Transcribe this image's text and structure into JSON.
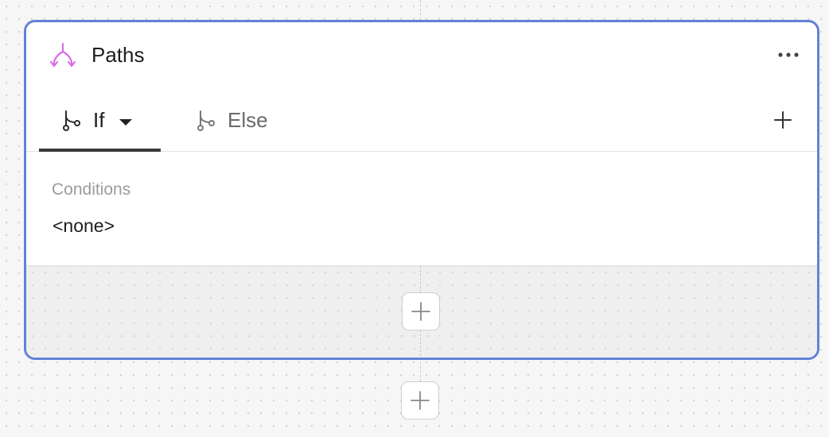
{
  "card": {
    "title": "Paths",
    "title_icon": "paths-split-icon",
    "accent_color": "#6182d6",
    "icon_color": "#d96de8",
    "more_icon": "ellipsis-icon"
  },
  "tabs": [
    {
      "label": "If",
      "icon": "branch-icon",
      "active": true,
      "has_dropdown": true
    },
    {
      "label": "Else",
      "icon": "branch-icon",
      "active": false,
      "has_dropdown": false
    }
  ],
  "add_path_icon": "plus-icon",
  "conditions": {
    "label": "Conditions",
    "value": "<none>"
  },
  "add_step_icons": [
    "plus-icon",
    "plus-icon"
  ]
}
